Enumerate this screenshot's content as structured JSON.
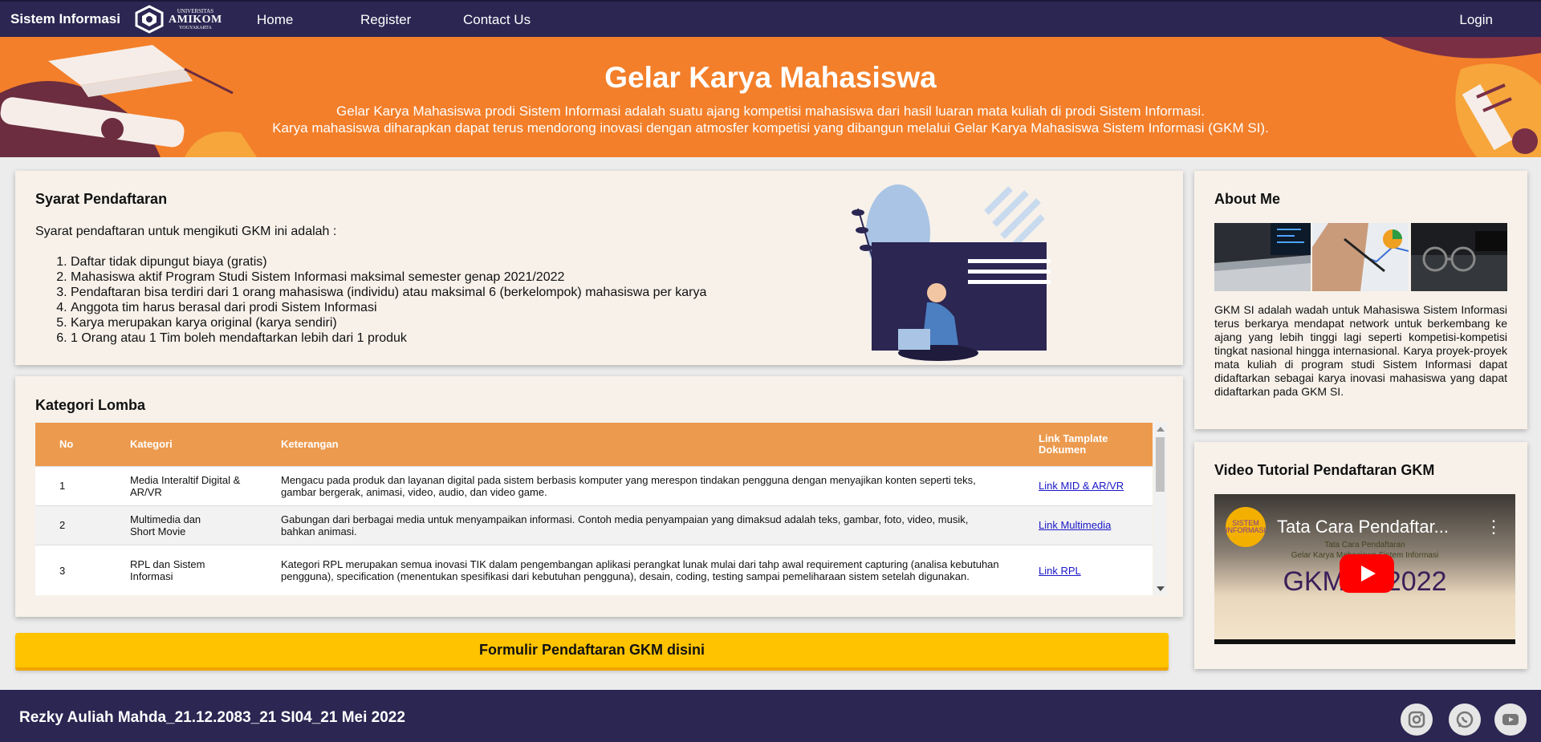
{
  "nav": {
    "brand": "Sistem Informasi",
    "logo": {
      "line1": "UNIVERSITAS",
      "line2": "AMIKOM",
      "line3": "YOGYAKARTA"
    },
    "links": [
      "Home",
      "Register",
      "Contact Us"
    ],
    "login": "Login"
  },
  "hero": {
    "title": "Gelar Karya Mahasiswa",
    "line1": "Gelar Karya Mahasiswa prodi Sistem Informasi adalah suatu ajang kompetisi mahasiswa dari hasil luaran mata kuliah di prodi Sistem Informasi.",
    "line2": "Karya mahasiswa diharapkan dapat terus mendorong inovasi dengan atmosfer kompetisi yang dibangun melalui Gelar Karya Mahasiswa Sistem Informasi (GKM SI)."
  },
  "syarat": {
    "title": "Syarat Pendaftaran",
    "intro": "Syarat pendaftaran untuk mengikuti GKM ini adalah :",
    "items": [
      "Daftar tidak dipungut biaya (gratis)",
      "Mahasiswa aktif Program Studi Sistem Informasi maksimal semester genap 2021/2022",
      "Pendaftaran bisa terdiri dari 1 orang mahasiswa (individu) atau maksimal 6 (berkelompok) mahasiswa per karya",
      "Anggota tim harus berasal dari prodi Sistem Informasi",
      "Karya merupakan karya original (karya sendiri)",
      "1 Orang atau 1 Tim boleh mendaftarkan lebih dari 1 produk"
    ]
  },
  "kategori": {
    "title": "Kategori Lomba",
    "headers": {
      "no": "No",
      "kategori": "Kategori",
      "keterangan": "Keterangan",
      "link": "Link Tamplate Dokumen"
    },
    "rows": [
      {
        "no": "1",
        "kategori": "Media Interaltif Digital & AR/VR",
        "keterangan": "Mengacu pada produk dan layanan digital pada sistem berbasis komputer yang merespon tindakan pengguna dengan menyajikan konten seperti teks, gambar bergerak, animasi, video, audio, dan video game.",
        "link": "Link MID & AR/VR"
      },
      {
        "no": "2",
        "kategori": "Multimedia dan Short Movie",
        "keterangan": "Gabungan dari berbagai media untuk menyampaikan informasi. Contoh media penyampaian yang dimaksud adalah teks, gambar, foto, video, musik, bahkan animasi.",
        "link": "Link Multimedia"
      },
      {
        "no": "3",
        "kategori": "RPL dan Sistem Informasi",
        "keterangan": "Kategori RPL merupakan semua inovasi TIK dalam pengembangan aplikasi perangkat lunak mulai dari tahp awal requirement capturing (analisa kebutuhan pengguna), specification (menentukan spesifikasi dari kebutuhan pengguna), desain, coding, testing sampai pemeliharaan sistem setelah digunakan.",
        "link": "Link RPL"
      }
    ]
  },
  "cta": {
    "label": "Formulir Pendaftaran GKM disini"
  },
  "about": {
    "title": "About Me",
    "text": "GKM SI adalah wadah untuk Mahasiswa Sistem Informasi terus berkarya mendapat network untuk berkembang ke ajang yang lebih tinggi lagi seperti kompetisi-kompetisi tingkat nasional hingga internasional. Karya proyek-proyek mata kuliah di program studi Sistem Informasi dapat didaftarkan sebagai karya inovasi mahasiswa yang dapat didaftarkan pada GKM SI."
  },
  "video": {
    "title": "Video Tutorial Pendaftaran GKM",
    "player_title": "Tata Cara Pendaftar...",
    "channel": "SISTEM INFORMASI",
    "sub1": "Tata Cara Pendaftaran",
    "sub2": "Gelar Karya Mahasiswa Sistem Informasi",
    "big": "GKM SI 2022"
  },
  "footer": {
    "credit": "Rezky Auliah Mahda_21.12.2083_21 SI04_21 Mei 2022"
  },
  "colors": {
    "navy": "#2b2652",
    "orange": "#f37f2a",
    "table_header": "#ec9a4e",
    "cta": "#ffc300",
    "card": "#f7f1ea"
  },
  "icons": [
    "instagram-icon",
    "whatsapp-icon",
    "youtube-icon"
  ]
}
